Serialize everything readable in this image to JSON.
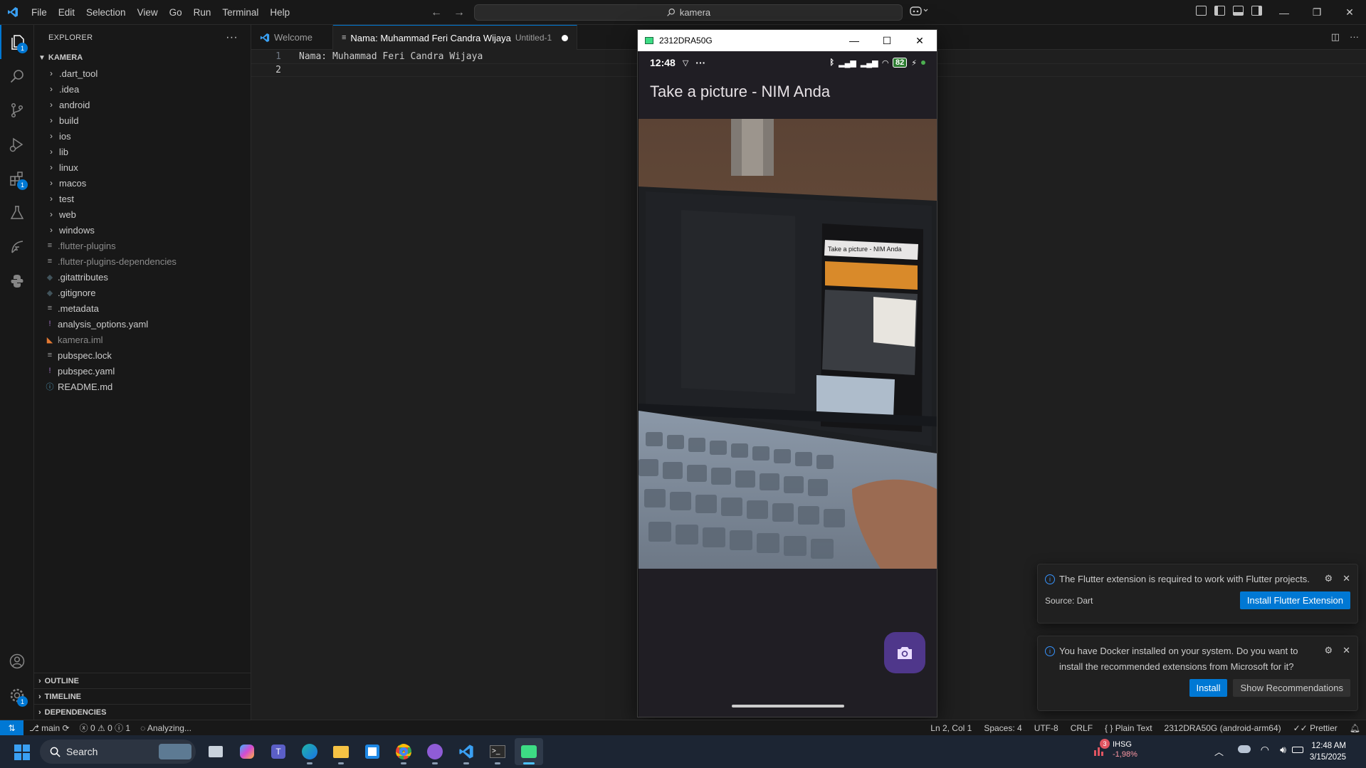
{
  "titlebar": {
    "menu": [
      "File",
      "Edit",
      "Selection",
      "View",
      "Go",
      "Run",
      "Terminal",
      "Help"
    ],
    "search_text": "kamera"
  },
  "activitybar": {
    "explorer_badge": "1",
    "extensions_badge": "1",
    "settings_badge": "1"
  },
  "sidebar": {
    "title": "EXPLORER",
    "root": "KAMERA",
    "folders": [
      ".dart_tool",
      ".idea",
      "android",
      "build",
      "ios",
      "lib",
      "linux",
      "macos",
      "test",
      "web",
      "windows"
    ],
    "files": [
      {
        "name": ".flutter-plugins",
        "icon": "lines-icon",
        "dim": true
      },
      {
        "name": ".flutter-plugins-dependencies",
        "icon": "lines-icon",
        "dim": true
      },
      {
        "name": ".gitattributes",
        "icon": "diamond-icon",
        "dim": false
      },
      {
        "name": ".gitignore",
        "icon": "diamond-icon",
        "dim": false
      },
      {
        "name": ".metadata",
        "icon": "lines-icon",
        "dim": false
      },
      {
        "name": "analysis_options.yaml",
        "icon": "exclaim-icon",
        "dim": false
      },
      {
        "name": "kamera.iml",
        "icon": "rss-icon",
        "dim": true
      },
      {
        "name": "pubspec.lock",
        "icon": "lines-icon",
        "dim": false
      },
      {
        "name": "pubspec.yaml",
        "icon": "exclaim-icon",
        "dim": false
      },
      {
        "name": "README.md",
        "icon": "info-icon",
        "dim": false
      }
    ],
    "sections": [
      "OUTLINE",
      "TIMELINE",
      "DEPENDENCIES"
    ]
  },
  "tabs": {
    "welcome": "Welcome",
    "active_title": "Nama: Muhammad Feri Candra Wijaya",
    "active_desc": "Untitled-1"
  },
  "editor": {
    "lines": [
      {
        "num": "1",
        "text": "Nama: Muhammad Feri Candra Wijaya"
      },
      {
        "num": "2",
        "text": ""
      }
    ]
  },
  "emulator": {
    "window_title": "2312DRA50G",
    "time": "12:48",
    "battery": "82",
    "app_title": "Take a picture - NIM Anda",
    "inner_app_title": "Take a picture - NIM Anda"
  },
  "notifications": {
    "flutter": {
      "message": "The Flutter extension is required to work with Flutter projects.",
      "source": "Source: Dart",
      "button": "Install Flutter Extension"
    },
    "docker": {
      "message": "You have Docker installed on your system. Do you want to install the recommended extensions from Microsoft for it?",
      "install": "Install",
      "show": "Show Recommendations"
    }
  },
  "statusbar": {
    "branch": "main",
    "errors": "0",
    "warnings": "0",
    "infos": "1",
    "analyzing": "Analyzing...",
    "position": "Ln 2, Col 1",
    "spaces": "Spaces: 4",
    "encoding": "UTF-8",
    "eol": "CRLF",
    "language": "Plain Text",
    "device": "2312DRA50G (android-arm64)",
    "prettier": "Prettier"
  },
  "taskbar": {
    "search": "Search",
    "stock_name": "IHSG",
    "stock_change": "-1,98%",
    "stock_badge": "3",
    "time": "12:48 AM",
    "date": "3/15/2025"
  },
  "colors": {
    "accent": "#0078d4",
    "fab": "#4f378b",
    "editor_bg": "#1f1f1f"
  }
}
